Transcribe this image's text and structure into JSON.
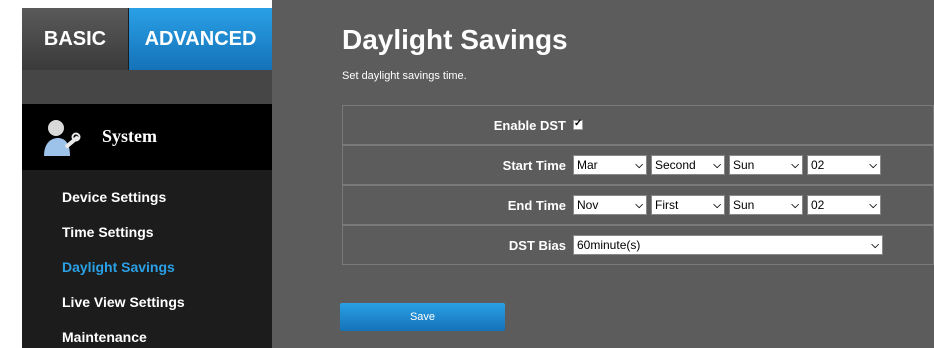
{
  "tabs": {
    "basic": "BASIC",
    "advanced": "ADVANCED"
  },
  "sidebar": {
    "section": "System",
    "items": [
      {
        "label": "Device Settings",
        "active": false
      },
      {
        "label": "Time Settings",
        "active": false
      },
      {
        "label": "Daylight Savings",
        "active": true
      },
      {
        "label": "Live View Settings",
        "active": false
      },
      {
        "label": "Maintenance",
        "active": false
      }
    ]
  },
  "main": {
    "title": "Daylight Savings",
    "subtitle": "Set daylight savings time.",
    "enable_dst": {
      "label": "Enable DST",
      "checked": true
    },
    "start_time": {
      "label": "Start Time",
      "month": "Mar",
      "week": "Second",
      "day": "Sun",
      "hour": "02"
    },
    "end_time": {
      "label": "End Time",
      "month": "Nov",
      "week": "First",
      "day": "Sun",
      "hour": "02"
    },
    "dst_bias": {
      "label": "DST Bias",
      "value": "60minute(s)"
    },
    "save_label": "Save"
  },
  "colors": {
    "accent": "#1e8fd6",
    "sidebar_bg": "#1c1c1c",
    "main_bg": "#5c5c5c",
    "active_item": "#2aa0e6"
  },
  "icons": {
    "system": "wrench-user-icon",
    "dropdown": "chevron-down-icon"
  }
}
